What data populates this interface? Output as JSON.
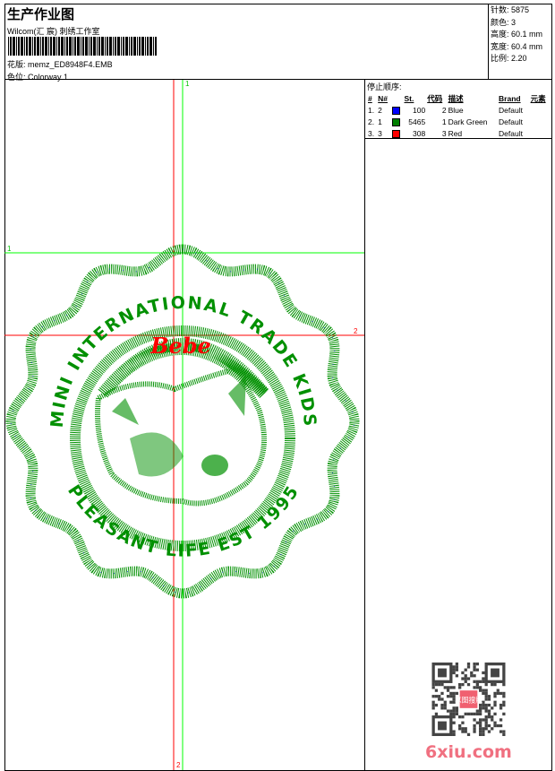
{
  "header": {
    "title": "生产作业图",
    "company": "Wilcom(汇 宸) 刺绣工作室",
    "file_label": "花版:",
    "file_name": "memz_ED8948F4.EMB",
    "colorway_label": "色位:",
    "colorway": "Colorway 1"
  },
  "info": [
    {
      "label": "针数:",
      "value": "5875"
    },
    {
      "label": "颜色:",
      "value": "3"
    },
    {
      "label": "高度:",
      "value": "60.1 mm"
    },
    {
      "label": "宽度:",
      "value": "60.4 mm"
    },
    {
      "label": "比例:",
      "value": "2.20"
    }
  ],
  "stop_sequence": {
    "title": "停止顺序:",
    "columns": [
      "#",
      "N#",
      "",
      "St.",
      "代码",
      "描述",
      "Brand",
      "元素"
    ],
    "rows": [
      {
        "idx": "1.",
        "n": "2",
        "color": "#0000ff",
        "st": "100",
        "code": "2",
        "desc": "Blue",
        "brand": "Default"
      },
      {
        "idx": "2.",
        "n": "1",
        "color": "#008000",
        "st": "5465",
        "code": "1",
        "desc": "Dark Green",
        "brand": "Default"
      },
      {
        "idx": "3.",
        "n": "3",
        "color": "#ff0000",
        "st": "308",
        "code": "3",
        "desc": "Red",
        "brand": "Default"
      }
    ]
  },
  "canvas": {
    "guide_labels": {
      "v_top": "1",
      "h_left": "1",
      "h_right": "2",
      "v_bottom": "2"
    },
    "design_text_top": "MINI INTERNATIONAL TRADE KIDS",
    "design_text_bottom": "PLEASANT LIFE EST 1995",
    "design_text_red": "Bebe",
    "colors": {
      "green": "#009000",
      "red": "#ff0000",
      "blue": "#0000ff",
      "guide_green": "#00ff00"
    }
  },
  "watermark": {
    "seal": "以图搜版",
    "brand": "6xiu.com"
  }
}
